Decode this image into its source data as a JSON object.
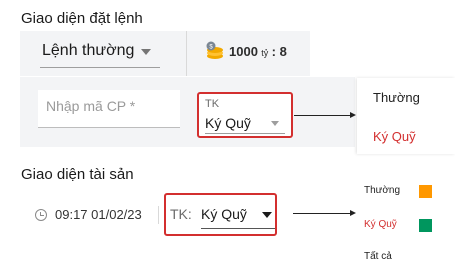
{
  "order_section": {
    "title": "Giao diện đặt lệnh",
    "order_type": {
      "value": "Lệnh thường"
    },
    "balance": {
      "amount": "1000",
      "unit": "tỷ",
      "suffix": ": 8"
    },
    "stock_input": {
      "placeholder": "Nhập mã CP *",
      "value": ""
    },
    "account": {
      "label": "TK",
      "value": "Ký Quỹ"
    },
    "dropdown": [
      {
        "label": "Thường",
        "color": "#212121"
      },
      {
        "label": "Ký Quỹ",
        "color": "#d32f2f"
      }
    ]
  },
  "asset_section": {
    "title": "Giao diện tài sản",
    "datetime": "09:17 01/02/23",
    "account": {
      "label": "TK:",
      "value": "Ký Quỹ"
    },
    "dropdown": [
      {
        "label": "Thường",
        "color": "#212121",
        "swatch": "#ff9800"
      },
      {
        "label": "Ký Quỹ",
        "color": "#d32f2f",
        "swatch": "#00965e"
      },
      {
        "label": "Tất cả",
        "color": "#212121"
      }
    ]
  },
  "colors": {
    "highlight": "#d32f2f",
    "accent_orange": "#ff9800",
    "accent_green": "#00965e"
  }
}
